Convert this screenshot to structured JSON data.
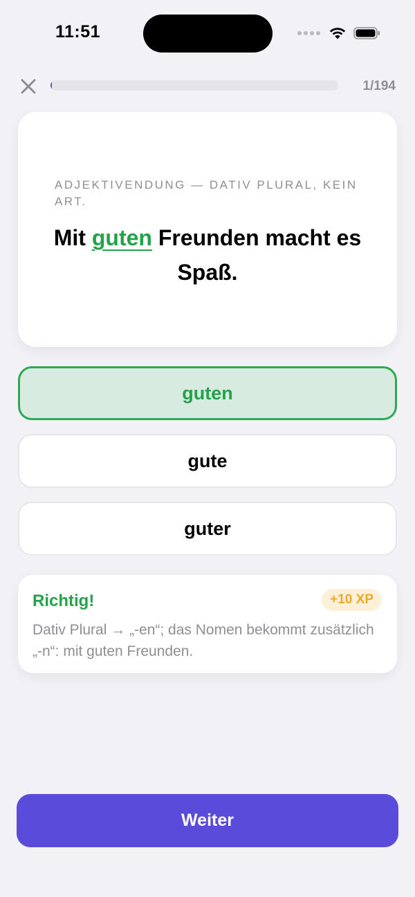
{
  "status_bar": {
    "time": "11:51"
  },
  "header": {
    "close_icon": "close-icon",
    "progress_fraction": 0.0052,
    "progress_count": "1/194"
  },
  "question": {
    "category": "ADJEKTIVENDUNG — DATIV PLURAL, KEIN ART.",
    "sentence_before": "Mit ",
    "answer": "guten",
    "sentence_after": " Freunden macht es Spaß."
  },
  "options": [
    {
      "label": "guten",
      "state": "correct"
    },
    {
      "label": "gute",
      "state": "default"
    },
    {
      "label": "guter",
      "state": "default"
    }
  ],
  "feedback": {
    "title": "Richtig!",
    "xp": "+10 XP",
    "text": "Dativ Plural → „-en“; das Nomen bekommt zusätzlich „-n“: mit guten Freunden."
  },
  "continue_button": {
    "label": "Weiter"
  },
  "colors": {
    "accent": "#5b4bdb",
    "correct": "#22a34a",
    "correct_bg": "#d7ebe1",
    "xp": "#f0a72a",
    "background": "#f1f1f6"
  }
}
